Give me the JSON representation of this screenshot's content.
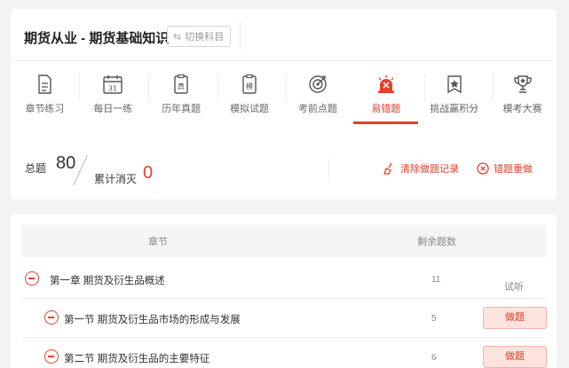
{
  "header": {
    "title": "期货从业 - 期货基础知识",
    "switch_label": "切换科目"
  },
  "tabs": [
    {
      "label": "章节练习",
      "icon": "document-icon",
      "active": false
    },
    {
      "label": "每日一练",
      "icon": "calendar-icon",
      "active": false
    },
    {
      "label": "历年真题",
      "icon": "clipboard-zhen-icon",
      "active": false
    },
    {
      "label": "模拟试题",
      "icon": "clipboard-mo-icon",
      "active": false
    },
    {
      "label": "考前点题",
      "icon": "target-icon",
      "active": false
    },
    {
      "label": "易错题",
      "icon": "alarm-icon",
      "active": true
    },
    {
      "label": "挑战赢积分",
      "icon": "bookmark-star-icon",
      "active": false
    },
    {
      "label": "模考大赛",
      "icon": "trophy-icon",
      "active": false
    }
  ],
  "stats": {
    "total_label": "总题",
    "total_value": "80",
    "eliminated_label": "累计消灭",
    "eliminated_value": "0",
    "clear_label": "清除做题记录",
    "redo_label": "错题重做"
  },
  "table": {
    "col_chapter": "章节",
    "col_remaining": "剩余题数",
    "rows": [
      {
        "title": "第一章 期货及衍生品概述",
        "count": "11",
        "action": "试听"
      },
      {
        "title": "第一节 期货及衍生品市场的形成与发展",
        "count": "5",
        "action": "做题"
      },
      {
        "title": "第二节 期货及衍生品的主要特征",
        "count": "6",
        "action": "做题"
      }
    ]
  },
  "colors": {
    "accent": "#e2412c"
  }
}
